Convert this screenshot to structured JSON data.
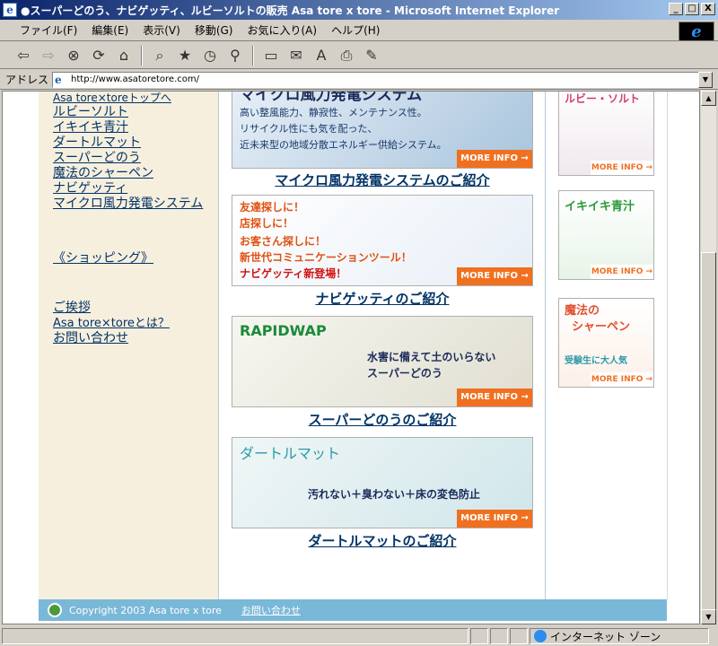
{
  "window": {
    "title": "●スーパーどのう、ナビゲッティ、ルビーソルトの販売  Asa tore x tore - Microsoft Internet Explorer",
    "min_label": "_",
    "max_label": "□",
    "close_label": "X"
  },
  "menu": [
    "ファイル(F)",
    "編集(E)",
    "表示(V)",
    "移動(G)",
    "お気に入り(A)",
    "ヘルプ(H)"
  ],
  "toolbar_icons": [
    "back-icon",
    "forward-icon",
    "stop-icon",
    "refresh-icon",
    "home-icon",
    "search-icon",
    "favorites-icon",
    "history-icon",
    "channels-icon",
    "fullscreen-icon",
    "mail-icon",
    "font-icon",
    "print-icon",
    "edit-icon"
  ],
  "address": {
    "label": "アドレス",
    "url": "http://www.asatoretore.com/"
  },
  "sidebar": {
    "links": [
      "Asa tore×toreトップへ",
      "ルビーソルト",
      "イキイキ青汁",
      "ダートルマット",
      "スーパーどのう",
      "魔法のシャーペン",
      "ナビゲッティ",
      "マイクロ風力発電システム"
    ],
    "shopping": "《ショッピング》",
    "bottom_links": [
      "ご挨拶",
      "Asa tore×toreとは？",
      "お問い合わせ"
    ]
  },
  "banners": [
    {
      "lines": [
        "マイクロ風力発電システム",
        "高い整風能力、静寂性、メンテナンス性。",
        "リサイクル性にも気を配った、",
        "近未来型の地域分散エネルギー供給システム。"
      ],
      "more": "MORE INFO →",
      "caption": "マイクロ風力発電システムのご紹介"
    },
    {
      "lines": [
        "友達探しに！",
        "店探しに！",
        "お客さん探しに！",
        "新世代コミュニケーションツール！",
        "ナビゲッティ新登場！"
      ],
      "more": "MORE INFO →",
      "caption": "ナビゲッティのご紹介"
    },
    {
      "lines": [
        "RAPIDWAP",
        "水害に備えて土のいらない",
        "スーパーどのう"
      ],
      "more": "MORE INFO →",
      "caption": "スーパーどのうのご紹介"
    },
    {
      "lines": [
        "ダートルマット",
        "汚れない＋臭わない＋床の変色防止"
      ],
      "more": "MORE INFO →",
      "caption": "ダートルマットのご紹介"
    }
  ],
  "side_banners": [
    {
      "lines": [
        "ルビー・ソルト"
      ],
      "more": "MORE INFO →"
    },
    {
      "lines": [
        "イキイキ青汁"
      ],
      "more": "MORE INFO →"
    },
    {
      "lines": [
        "魔法の",
        "シャーペン",
        "受験生に大人気"
      ],
      "more": "MORE INFO →"
    }
  ],
  "footer": {
    "copyright": "Copyright 2003 Asa tore x tore",
    "contact": "お問い合わせ"
  },
  "status": {
    "zone": "インターネット ゾーン"
  }
}
